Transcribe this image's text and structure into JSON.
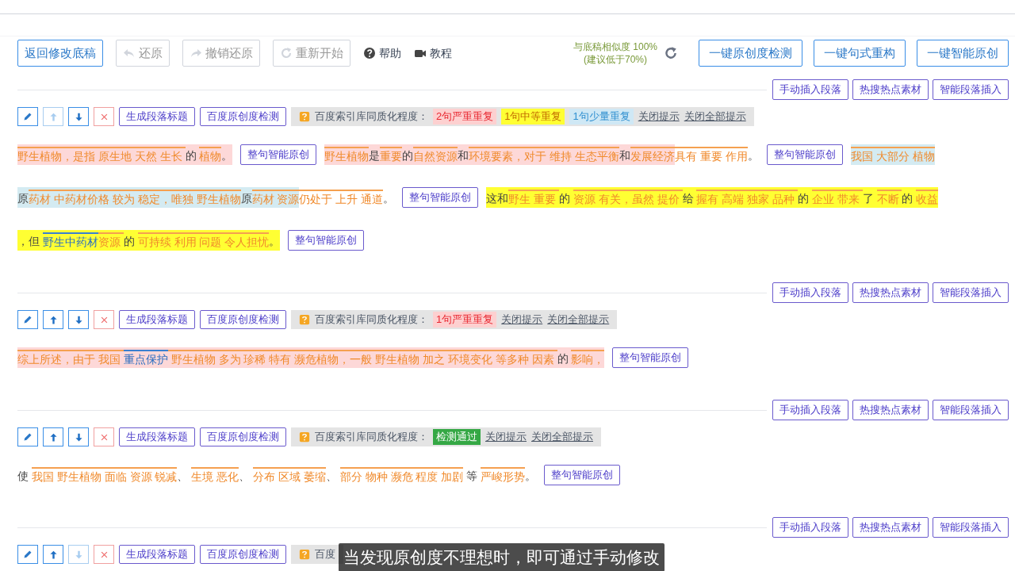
{
  "toolbar": {
    "buttons": [
      {
        "label": "返回修改底稿",
        "disabled": false
      },
      {
        "label": "还原",
        "disabled": true
      },
      {
        "label": "撤销还原",
        "disabled": true
      },
      {
        "label": "重新开始",
        "disabled": true
      }
    ],
    "links": [
      {
        "label": "帮助"
      },
      {
        "label": "教程"
      }
    ],
    "similarity": {
      "label": "与底稿相似度",
      "value": "100%",
      "note": "(建议低于70%)"
    },
    "actions": [
      "一键原创度检测",
      "一键句式重构",
      "一键智能原创"
    ]
  },
  "paragraphs": [
    {
      "insert_buttons": [
        "手动插入段落",
        "热搜热点素材",
        "智能段落插入"
      ],
      "tools": {
        "up_disabled": true,
        "down_disabled": false,
        "buttons": [
          "生成段落标题",
          "百度原创度检测"
        ]
      },
      "hints": {
        "label": "百度索引库同质化程度：",
        "tags": [
          {
            "kind": "severe",
            "text": "2句严重重复"
          },
          {
            "kind": "moderate",
            "text": "1句中等重复"
          },
          {
            "kind": "minor",
            "text": "1句少量重复"
          }
        ],
        "links": [
          "关闭提示",
          "关闭全部提示"
        ]
      },
      "lines": [
        [
          {
            "kind": "severe",
            "segments": [
              {
                "kind": "term",
                "text": "野生植物，是指 原生地 天然 生长 "
              },
              {
                "kind": "plain",
                "text": "的 "
              },
              {
                "kind": "term",
                "text": "植物"
              },
              {
                "kind": "plain",
                "text": "。"
              }
            ]
          },
          {
            "kind": "button",
            "text": "整句智能原创"
          },
          {
            "kind": "severe",
            "segments": [
              {
                "kind": "term",
                "text": "野生植物"
              },
              {
                "kind": "plain",
                "text": "是"
              },
              {
                "kind": "term",
                "text": "重要"
              },
              {
                "kind": "plain",
                "text": "的"
              },
              {
                "kind": "term",
                "text": "自然资源"
              },
              {
                "kind": "plain",
                "text": "和"
              },
              {
                "kind": "term",
                "text": "环境要素，对于 维持 生态平衡"
              },
              {
                "kind": "plain",
                "text": "和"
              },
              {
                "kind": "term",
                "text": "发展经济"
              }
            ]
          },
          {
            "kind": "plain",
            "segments": [
              {
                "kind": "term",
                "text": "具有 重要 作用"
              },
              {
                "kind": "plain",
                "text": "。"
              }
            ]
          },
          {
            "kind": "button",
            "text": "整句智能原创"
          },
          {
            "kind": "minor",
            "segments": [
              {
                "kind": "term",
                "text": "我国 大部分 植物"
              }
            ]
          }
        ],
        [
          {
            "kind": "minor",
            "segments": [
              {
                "kind": "plain",
                "text": "原"
              },
              {
                "kind": "term",
                "text": "药材 中药材价格 较为 稳定，唯独 野生植物"
              },
              {
                "kind": "plain",
                "text": "原"
              },
              {
                "kind": "term",
                "text": "药材 资源"
              }
            ]
          },
          {
            "kind": "plain",
            "segments": [
              {
                "kind": "term",
                "text": "仍处于 上升 通道"
              },
              {
                "kind": "plain",
                "text": "。"
              }
            ]
          },
          {
            "kind": "button",
            "text": "整句智能原创"
          },
          {
            "kind": "moderate",
            "segments": [
              {
                "kind": "plain",
                "text": "这和"
              },
              {
                "kind": "term",
                "text": "野生 重要 "
              },
              {
                "kind": "plain",
                "text": "的 "
              },
              {
                "kind": "term",
                "text": "资源 有关，虽然 提价 "
              },
              {
                "kind": "plain",
                "text": "给 "
              },
              {
                "kind": "term",
                "text": "握有 高端 独家 品种 "
              },
              {
                "kind": "plain",
                "text": "的 "
              },
              {
                "kind": "term",
                "text": "企业 带来 "
              },
              {
                "kind": "plain",
                "text": "了 "
              },
              {
                "kind": "term",
                "text": "不断 "
              },
              {
                "kind": "plain",
                "text": "的 "
              },
              {
                "kind": "term",
                "text": "收益"
              }
            ]
          }
        ],
        [
          {
            "kind": "moderate",
            "segments": [
              {
                "kind": "plain",
                "text": "，但 "
              },
              {
                "kind": "key",
                "text": "野生中药材"
              },
              {
                "kind": "term",
                "text": "资源 "
              },
              {
                "kind": "plain",
                "text": "的 "
              },
              {
                "kind": "term",
                "text": "可持续 利用 问题 令人担忧"
              },
              {
                "kind": "plain",
                "text": "。"
              }
            ]
          },
          {
            "kind": "button",
            "text": "整句智能原创"
          }
        ]
      ]
    },
    {
      "insert_buttons": [
        "手动插入段落",
        "热搜热点素材",
        "智能段落插入"
      ],
      "tools": {
        "up_disabled": false,
        "down_disabled": false,
        "buttons": [
          "生成段落标题",
          "百度原创度检测"
        ]
      },
      "hints": {
        "label": "百度索引库同质化程度：",
        "tags": [
          {
            "kind": "severe",
            "text": "1句严重重复"
          }
        ],
        "links": [
          "关闭提示",
          "关闭全部提示"
        ]
      },
      "lines": [
        [
          {
            "kind": "severe",
            "segments": [
              {
                "kind": "term",
                "text": "综上所述，由于 我国 "
              },
              {
                "kind": "key",
                "text": "重点保护"
              },
              {
                "kind": "term",
                "text": " 野生植物 多为 珍稀 特有 濒危植物，一般 野生植物 加之 环境变化 等多种 因素 "
              },
              {
                "kind": "plain",
                "text": "的 "
              },
              {
                "kind": "term",
                "text": "影响，"
              }
            ]
          },
          {
            "kind": "button",
            "text": "整句智能原创"
          }
        ]
      ]
    },
    {
      "insert_buttons": [
        "手动插入段落",
        "热搜热点素材",
        "智能段落插入"
      ],
      "tools": {
        "up_disabled": false,
        "down_disabled": false,
        "buttons": [
          "生成段落标题",
          "百度原创度检测"
        ]
      },
      "hints": {
        "label": "百度索引库同质化程度：",
        "tags": [
          {
            "kind": "pass",
            "text": "检测通过"
          }
        ],
        "links": [
          "关闭提示",
          "关闭全部提示"
        ]
      },
      "lines": [
        [
          {
            "kind": "plain",
            "segments": [
              {
                "kind": "plain",
                "text": "使 "
              },
              {
                "kind": "term",
                "text": "我国 野生植物 面临 资源 锐减"
              },
              {
                "kind": "plain",
                "text": "、 "
              },
              {
                "kind": "term",
                "text": "生境 恶化"
              },
              {
                "kind": "plain",
                "text": "、 "
              },
              {
                "kind": "term",
                "text": "分布 区域 萎缩"
              },
              {
                "kind": "plain",
                "text": "、 "
              },
              {
                "kind": "term",
                "text": "部分 物种 濒危 程度 加剧"
              },
              {
                "kind": "plain",
                "text": " 等 "
              },
              {
                "kind": "term",
                "text": "严峻形势"
              },
              {
                "kind": "plain",
                "text": "。"
              }
            ]
          },
          {
            "kind": "button",
            "text": "整句智能原创"
          }
        ]
      ]
    },
    {
      "insert_buttons": [
        "手动插入段落",
        "热搜热点素材",
        "智能段落插入"
      ],
      "tools": {
        "up_disabled": false,
        "down_disabled": true,
        "buttons": [
          "生成段落标题",
          "百度原创度检测"
        ]
      },
      "hints": {
        "label": "百度"
      }
    }
  ],
  "caption": "当发现原创度不理想时，即可通过手动修改"
}
